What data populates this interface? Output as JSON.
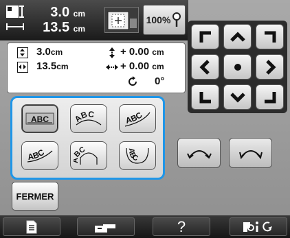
{
  "header": {
    "size_height_value": "3.0",
    "size_height_unit": "cm",
    "size_width_value": "13.5",
    "size_width_unit": "cm",
    "zoom_label": "100%"
  },
  "info": {
    "height_value": "3.0",
    "height_unit": "cm",
    "width_value": "13.5",
    "width_unit": "cm",
    "offset_vertical_value": "+ 0.00",
    "offset_vertical_unit": "cm",
    "offset_horizontal_value": "+ 0.00",
    "offset_horizontal_unit": "cm",
    "rotation_value": "0°"
  },
  "arrange": {
    "items": [
      {
        "text": "ABC",
        "icon": "text-straight-icon",
        "selected": true
      },
      {
        "text": "ABC",
        "icon": "text-arc-up-icon",
        "selected": false
      },
      {
        "text": "ABC",
        "icon": "text-arc-up-right-icon",
        "selected": false
      },
      {
        "text": "ABC",
        "icon": "text-slant-icon",
        "selected": false
      },
      {
        "text": "ABC",
        "icon": "text-arch-icon",
        "selected": false
      },
      {
        "text": "ABC",
        "icon": "text-circle-icon",
        "selected": false
      }
    ]
  },
  "buttons": {
    "close_label": "FERMER"
  },
  "bottom": {
    "help_label": "?"
  },
  "colors": {
    "accent": "#1f96e8",
    "dark_bar": "#1a1a1a",
    "panel_bg": "#9c9c9c"
  }
}
